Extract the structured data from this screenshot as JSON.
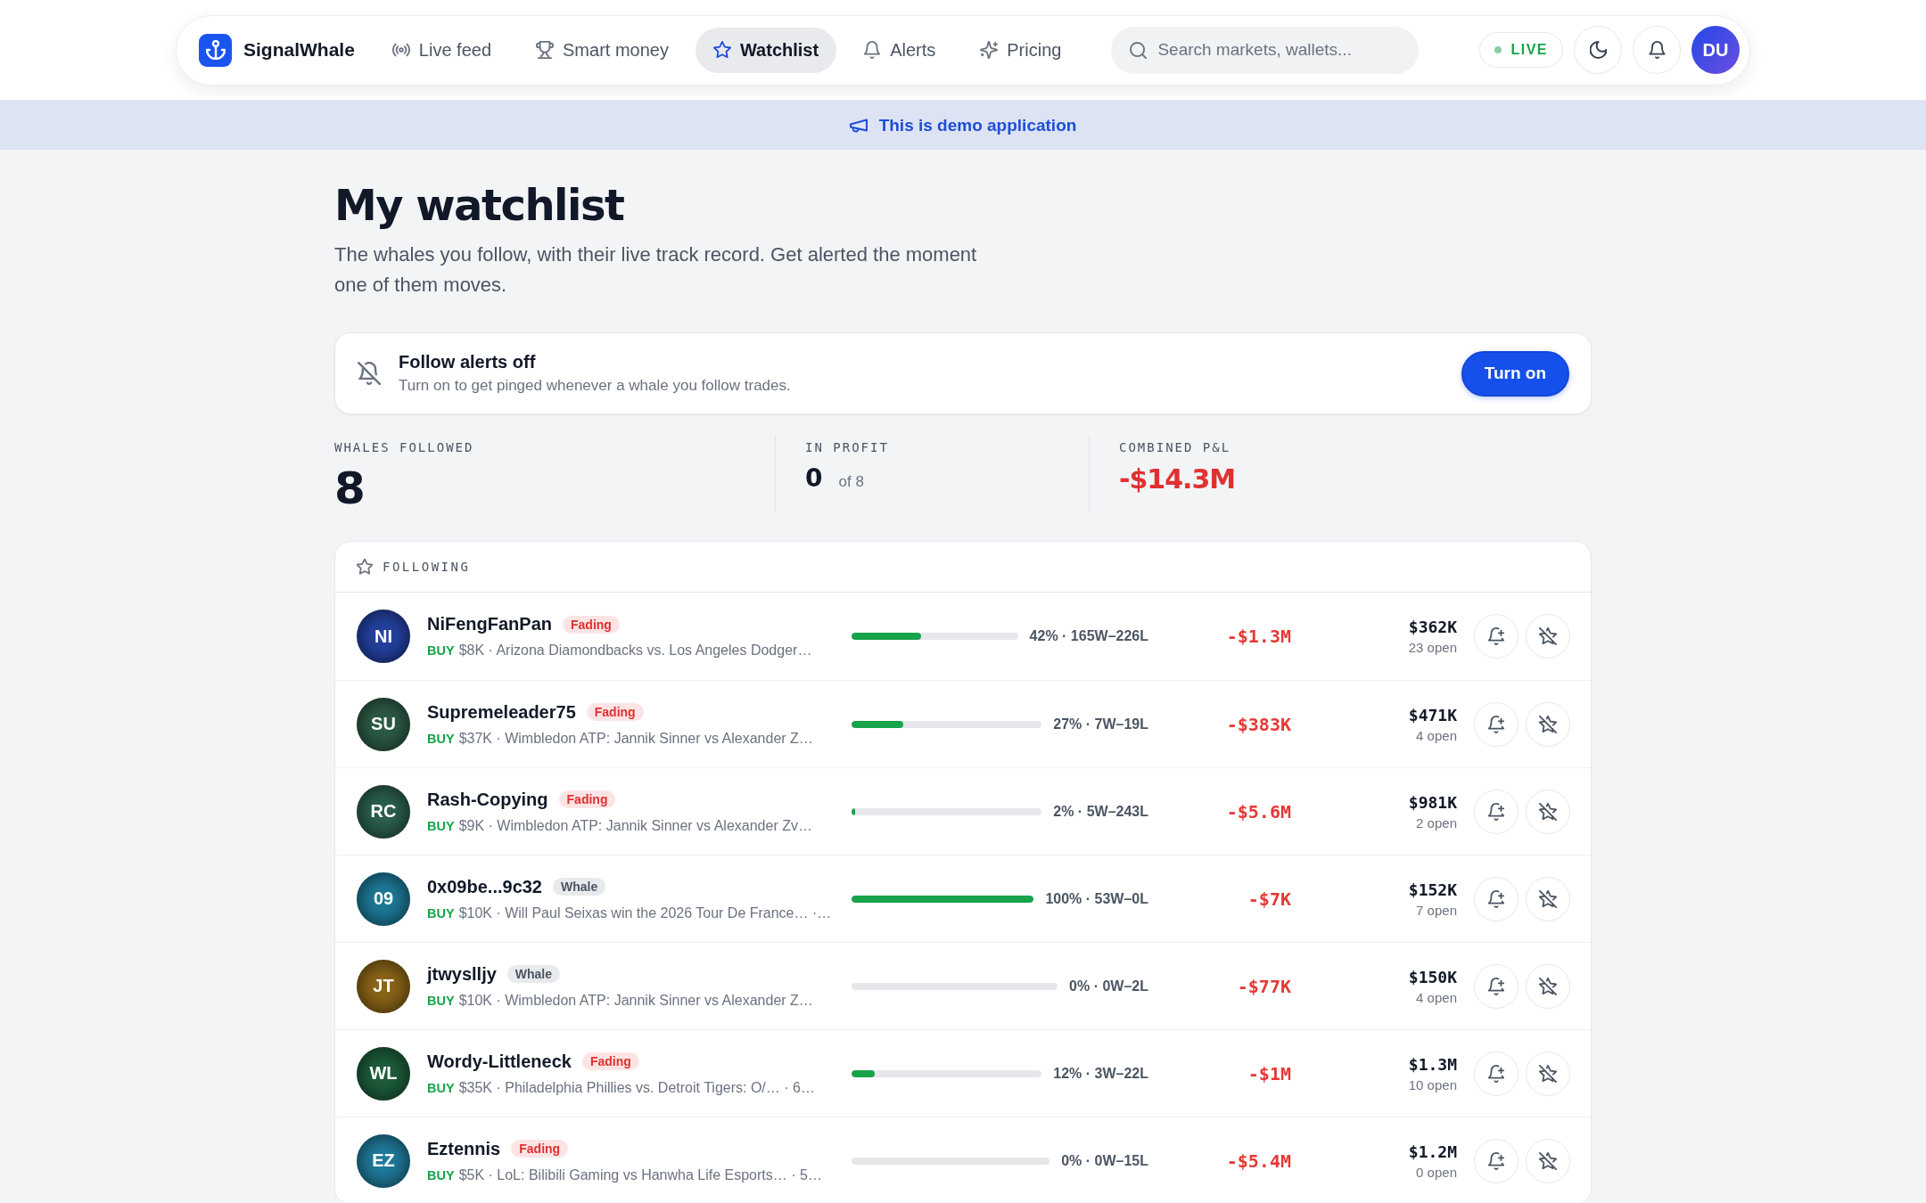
{
  "nav": {
    "brand": "SignalWhale",
    "tabs": [
      {
        "label": "Live feed",
        "selected": false
      },
      {
        "label": "Smart money",
        "selected": false
      },
      {
        "label": "Watchlist",
        "selected": true
      },
      {
        "label": "Alerts",
        "selected": false
      },
      {
        "label": "Pricing",
        "selected": false
      }
    ],
    "search": {
      "placeholder": "Search markets, wallets..."
    },
    "live_badge": "LIVE",
    "avatar": "DU"
  },
  "banner": {
    "text": "This is demo application"
  },
  "header": {
    "title": "My watchlist",
    "subtitle": "The whales you follow, with their live track record. Get alerted the moment one of them moves."
  },
  "alerts_card": {
    "title": "Follow alerts off",
    "text": "Turn on to get pinged whenever a whale you follow trades.",
    "button": "Turn on"
  },
  "stats": [
    {
      "label": "WHALES FOLLOWED",
      "value": "8",
      "kind": "total"
    },
    {
      "label": "IN PROFIT",
      "value": "0",
      "suffix": "of 8",
      "kind": "fraction"
    },
    {
      "label": "COMBINED P&L",
      "value": "-$14.3M",
      "kind": "money"
    }
  ],
  "following": {
    "title": "FOLLOWING",
    "rows": [
      {
        "initials": "NI",
        "color": "#23409e",
        "name": "NiFengFanPan",
        "tag": {
          "label": "Fading",
          "kind": "fading"
        },
        "side": "BUY",
        "trade": "$8K · Arizona Diamondbacks vs. Los Angeles Dodger…",
        "level": 0.42,
        "record": "42% · 165W–226L",
        "pnl": "-$1.3M",
        "value": "$362K",
        "open": "23 open"
      },
      {
        "initials": "SU",
        "color": "#2c5a44",
        "name": "Supremeleader75",
        "tag": {
          "label": "Fading",
          "kind": "fading"
        },
        "side": "BUY",
        "trade": "$37K · Wimbledon ATP: Jannik Sinner vs Alexander Z…",
        "level": 0.27,
        "record": "27% · 7W–19L",
        "pnl": "-$383K",
        "value": "$471K",
        "open": "4 open"
      },
      {
        "initials": "RC",
        "color": "#2b5e4c",
        "name": "Rash-Copying",
        "tag": {
          "label": "Fading",
          "kind": "fading"
        },
        "side": "BUY",
        "trade": "$9K · Wimbledon ATP: Jannik Sinner vs Alexander Zv…",
        "level": 0.02,
        "record": "2% · 5W–243L",
        "pnl": "-$5.6M",
        "value": "$981K",
        "open": "2 open"
      },
      {
        "initials": "09",
        "color": "#1d7896",
        "name": "0x09be...9c32",
        "tag": {
          "label": "Whale",
          "kind": "whale"
        },
        "side": "BUY",
        "trade": "$10K · Will Paul Seixas win the 2026 Tour De France… ·…",
        "level": 1.0,
        "record": "100% · 53W–0L",
        "pnl": "-$7K",
        "value": "$152K",
        "open": "7 open"
      },
      {
        "initials": "JT",
        "color": "#8a6418",
        "name": "jtwyslljy",
        "tag": {
          "label": "Whale",
          "kind": "whale"
        },
        "side": "BUY",
        "trade": "$10K · Wimbledon ATP: Jannik Sinner vs Alexander Z…",
        "level": 0,
        "record": "0% · 0W–2L",
        "pnl": "-$77K",
        "value": "$150K",
        "open": "4 open"
      },
      {
        "initials": "WL",
        "color": "#1d5c3a",
        "name": "Wordy-Littleneck",
        "tag": {
          "label": "Fading",
          "kind": "fading"
        },
        "side": "BUY",
        "trade": "$35K · Philadelphia Phillies vs. Detroit Tigers: O/… · 6…",
        "level": 0.12,
        "record": "12% · 3W–22L",
        "pnl": "-$1M",
        "value": "$1.3M",
        "open": "10 open"
      },
      {
        "initials": "EZ",
        "color": "#1f7a9a",
        "name": "Eztennis",
        "tag": {
          "label": "Fading",
          "kind": "fading"
        },
        "side": "BUY",
        "trade": "$5K · LoL: Bilibili Gaming vs Hanwha Life Esports… · 5…",
        "level": 0,
        "record": "0% · 0W–15L",
        "pnl": "-$5.4M",
        "value": "$1.2M",
        "open": "0 open"
      }
    ]
  }
}
